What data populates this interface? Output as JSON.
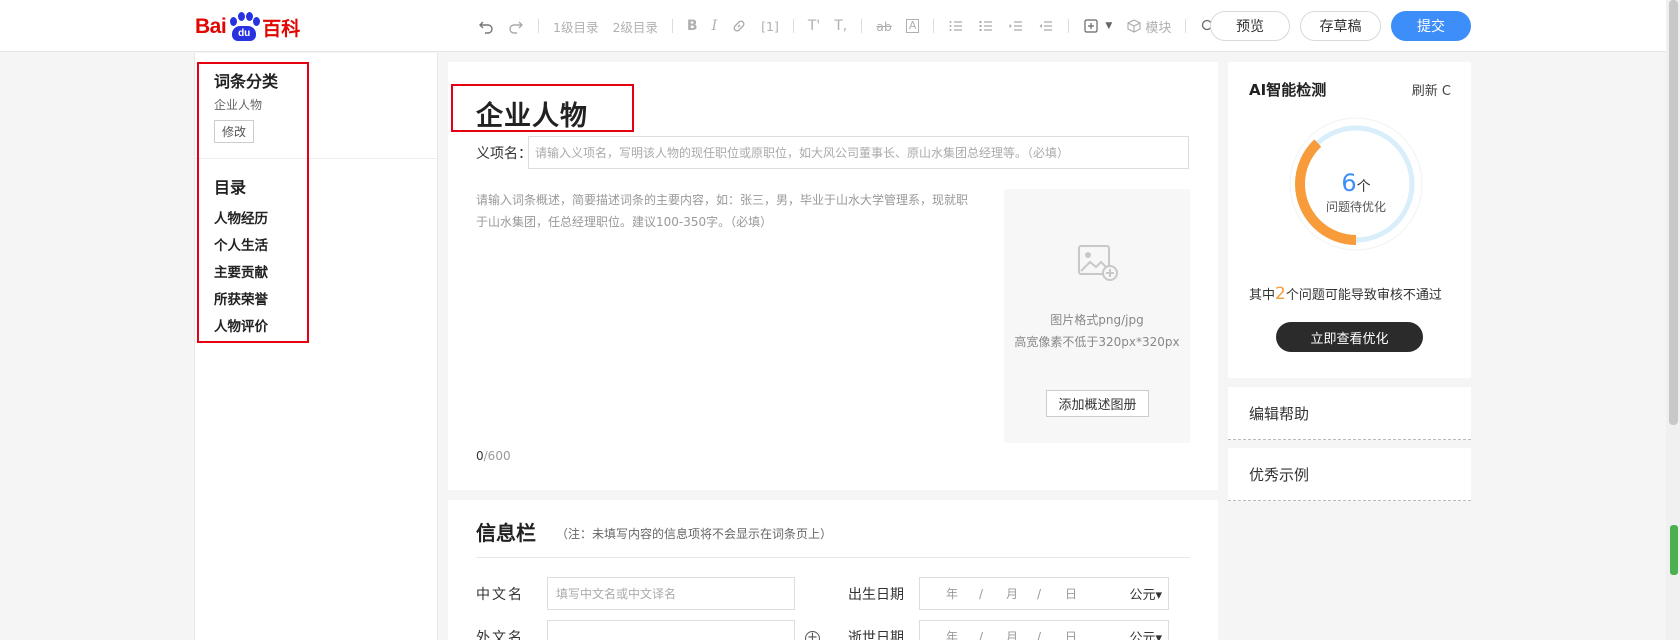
{
  "header": {
    "logo": {
      "bai": "Bai",
      "du": "du",
      "baike": "百科"
    },
    "toolbar": {
      "undo": "undo-icon",
      "redo": "redo-icon",
      "toc1": "1级目录",
      "toc2": "2级目录",
      "bold": "B",
      "italic": "I",
      "link": "link-icon",
      "ref": "[1]",
      "superscript": "T'",
      "subscript": "T,",
      "strikethrough": "ab",
      "textbox": "A",
      "ol": "ordered-list-icon",
      "ul": "unordered-list-icon",
      "indent": "indent-icon",
      "outdent": "outdent-icon",
      "insert": "insert-icon",
      "module_label": "模块",
      "search": "search-icon"
    },
    "preview_label": "预览",
    "draft_label": "存草稿",
    "submit_label": "提交"
  },
  "sidebar": {
    "category_title": "词条分类",
    "category_value": "企业人物",
    "edit_label": "修改",
    "toc_title": "目录",
    "toc_items": [
      "人物经历",
      "个人生活",
      "主要贡献",
      "所获荣誉",
      "人物评价"
    ]
  },
  "main": {
    "entry_title": "企业人物",
    "yixiang_label": "义项名：",
    "yixiang_placeholder": "请输入义项名，写明该人物的现任职位或原职位，如大风公司董事长、原山水集团总经理等。（必填）",
    "summary_placeholder": "请输入词条概述，简要描述词条的主要内容，如：张三，男，毕业于山水大学管理系，现就职于山水集团，任总经理职位。建议100-350字。（必填）",
    "image_hint_1": "图片格式png/jpg",
    "image_hint_2": "高宽像素不低于320px*320px",
    "add_image_label": "添加概述图册",
    "char_count_current": "0",
    "char_count_max": "/600"
  },
  "info": {
    "title": "信息栏",
    "note": "（注：未填写内容的信息项将不会显示在词条页上）",
    "fields": {
      "chinese_name_label": "中文名",
      "chinese_name_placeholder": "填写中文名或中文译名",
      "foreign_name_label": "外文名",
      "birth_date_label": "出生日期",
      "death_date_label": "逝世日期",
      "date_year": "年",
      "date_month": "月",
      "date_day": "日",
      "date_sep": "/",
      "era": "公元▾"
    }
  },
  "ai": {
    "title": "AI智能检测",
    "refresh_label": "刷新 C",
    "issue_count": "6",
    "issue_unit": "个",
    "issue_sub": "问题待优化",
    "summary_prefix": "其中",
    "summary_count": "2",
    "summary_suffix": "个问题可能导致审核不通过",
    "action_label": "立即查看优化",
    "issues_total": 6,
    "progress_fraction": 0.38,
    "ring_color": "#f79b3b",
    "ring_track_color": "#d9eefb"
  },
  "links": {
    "edit_help": "编辑帮助",
    "examples": "优秀示例"
  },
  "colors": {
    "accent": "#3d8ef8",
    "highlight_border": "#e60012",
    "logo_red": "#e10602",
    "logo_blue": "#2932e1"
  }
}
